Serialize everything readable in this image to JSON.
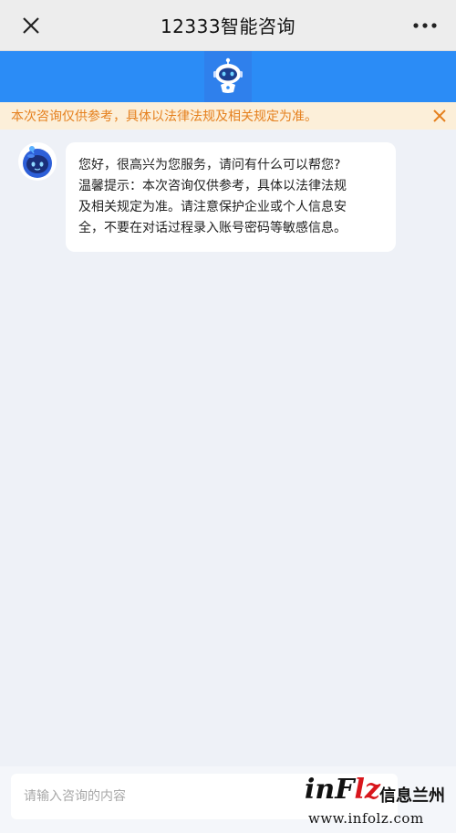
{
  "header": {
    "title": "12333智能咨询",
    "close_icon": "close-icon",
    "more_icon": "more-dots-icon"
  },
  "banner": {
    "icon": "robot-icon",
    "color": "#2b8cf6"
  },
  "notice": {
    "text": "本次咨询仅供参考，具体以法律法规及相关规定为准。",
    "text_color": "#e5801e",
    "background": "#fcefd9",
    "close_icon": "close-icon"
  },
  "chat": {
    "messages": [
      {
        "sender": "bot",
        "avatar_icon": "robot-avatar-icon",
        "lines": [
          "您好，很高兴为您服务，请问有什么可以帮您?",
          "温馨提示：本次咨询仅供参考，具体以法律法规",
          "及相关规定为准。请注意保护企业或个人信息安",
          "全，不要在对话过程录入账号密码等敏感信息。"
        ]
      }
    ]
  },
  "input": {
    "placeholder": "请输入咨询的内容",
    "value": ""
  },
  "watermark": {
    "logo_prefix": "inF",
    "logo_suffix": "lz",
    "chinese": "信息兰州",
    "url": "www.infolz.com"
  }
}
